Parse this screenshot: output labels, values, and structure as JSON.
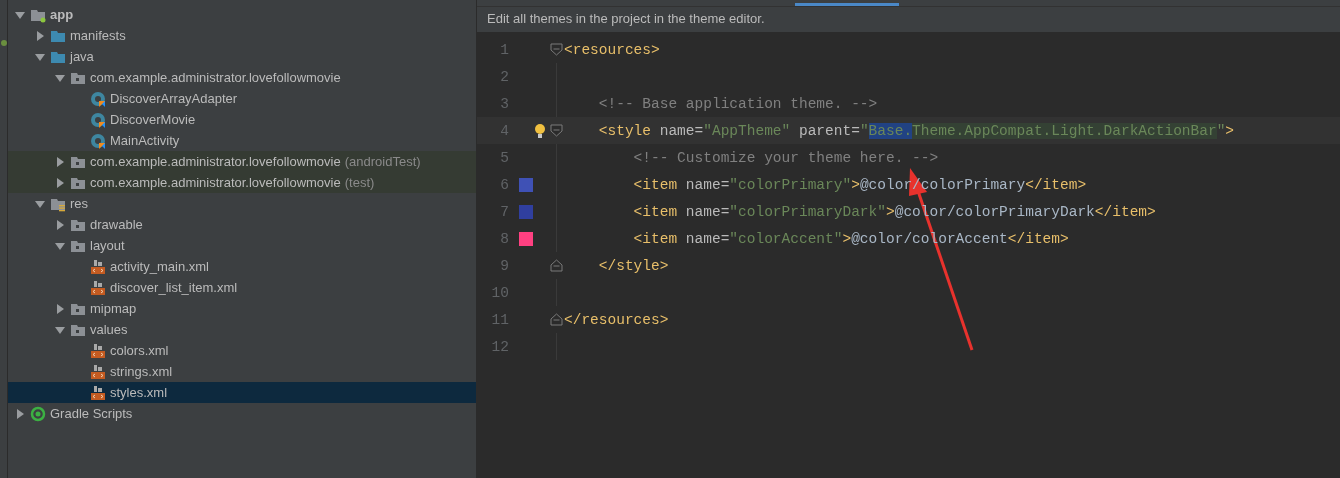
{
  "project_tree": [
    {
      "label": "app",
      "kind": "module",
      "expanded": true,
      "selected": false,
      "tinted": false,
      "children": [
        {
          "label": "manifests",
          "kind": "folder",
          "expanded": false,
          "selected": false,
          "tinted": false
        },
        {
          "label": "java",
          "kind": "folder",
          "expanded": true,
          "selected": false,
          "tinted": false,
          "children": [
            {
              "label": "com.example.administrator.lovefollowmovie",
              "kind": "package",
              "expanded": true,
              "selected": false,
              "tinted": false,
              "children": [
                {
                  "label": "DiscoverArrayAdapter",
                  "kind": "class",
                  "selected": false,
                  "tinted": false
                },
                {
                  "label": "DiscoverMovie",
                  "kind": "class",
                  "selected": false,
                  "tinted": false
                },
                {
                  "label": "MainActivity",
                  "kind": "class",
                  "selected": false,
                  "tinted": false
                }
              ]
            },
            {
              "label": "com.example.administrator.lovefollowmovie",
              "suffix": "(androidTest)",
              "kind": "package",
              "expanded": false,
              "selected": false,
              "tinted": true
            },
            {
              "label": "com.example.administrator.lovefollowmovie",
              "suffix": "(test)",
              "kind": "package",
              "expanded": false,
              "selected": false,
              "tinted": true
            }
          ]
        },
        {
          "label": "res",
          "kind": "resfolder",
          "expanded": true,
          "selected": false,
          "tinted": false,
          "children": [
            {
              "label": "drawable",
              "kind": "package",
              "expanded": false,
              "selected": false,
              "tinted": false
            },
            {
              "label": "layout",
              "kind": "package",
              "expanded": true,
              "selected": false,
              "tinted": false,
              "children": [
                {
                  "label": "activity_main.xml",
                  "kind": "xml",
                  "selected": false,
                  "tinted": false
                },
                {
                  "label": "discover_list_item.xml",
                  "kind": "xml",
                  "selected": false,
                  "tinted": false
                }
              ]
            },
            {
              "label": "mipmap",
              "kind": "package",
              "expanded": false,
              "selected": false,
              "tinted": false
            },
            {
              "label": "values",
              "kind": "package",
              "expanded": true,
              "selected": false,
              "tinted": false,
              "children": [
                {
                  "label": "colors.xml",
                  "kind": "xml",
                  "selected": false,
                  "tinted": false
                },
                {
                  "label": "strings.xml",
                  "kind": "xml",
                  "selected": false,
                  "tinted": false
                },
                {
                  "label": "styles.xml",
                  "kind": "xml",
                  "selected": true,
                  "tinted": false
                }
              ]
            }
          ]
        }
      ]
    },
    {
      "label": "Gradle Scripts",
      "kind": "gradle",
      "expanded": false,
      "selected": false,
      "tinted": false
    }
  ],
  "editor": {
    "notice": "Edit all themes in the project in the theme editor.",
    "lines": [
      {
        "number": "1",
        "fold_start": true,
        "current": false,
        "segments": [
          {
            "kind": "tag",
            "text": "<resources>"
          }
        ]
      },
      {
        "number": "2",
        "current": false
      },
      {
        "number": "3",
        "current": false,
        "segments": [
          {
            "kind": "comment",
            "text": "    <!-- Base application theme. -->"
          }
        ]
      },
      {
        "number": "4",
        "fold_start": true,
        "bulb": true,
        "current": true,
        "segments": [
          {
            "kind": "tag",
            "text": "    <style "
          },
          {
            "kind": "attr",
            "text": "name="
          },
          {
            "kind": "str",
            "text": "\"AppTheme\""
          },
          {
            "kind": "attr",
            "text": " parent="
          },
          {
            "kind": "str",
            "text": "\""
          },
          {
            "kind": "str",
            "text": "Base.",
            "selected": true,
            "match": true
          },
          {
            "kind": "str",
            "text": "Theme.AppCompat.Light.DarkActionBar",
            "match": true
          },
          {
            "kind": "str",
            "text": "\""
          },
          {
            "kind": "tag",
            "text": ">"
          }
        ]
      },
      {
        "number": "5",
        "current": false,
        "segments": [
          {
            "kind": "comment",
            "text": "        <!-- Customize your theme here. -->"
          }
        ]
      },
      {
        "number": "6",
        "color": "#3f51b5",
        "current": false,
        "segments": [
          {
            "kind": "tag",
            "text": "        <item "
          },
          {
            "kind": "attr",
            "text": "name="
          },
          {
            "kind": "str",
            "text": "\"colorPrimary\""
          },
          {
            "kind": "tag",
            "text": ">"
          },
          {
            "kind": "text",
            "text": "@color/colorPrimary"
          },
          {
            "kind": "tag",
            "text": "</item>"
          }
        ]
      },
      {
        "number": "7",
        "color": "#303f9f",
        "current": false,
        "segments": [
          {
            "kind": "tag",
            "text": "        <item "
          },
          {
            "kind": "attr",
            "text": "name="
          },
          {
            "kind": "str",
            "text": "\"colorPrimaryDark\""
          },
          {
            "kind": "tag",
            "text": ">"
          },
          {
            "kind": "text",
            "text": "@color/colorPrimaryDark"
          },
          {
            "kind": "tag",
            "text": "</item>"
          }
        ]
      },
      {
        "number": "8",
        "color": "#ff4081",
        "current": false,
        "segments": [
          {
            "kind": "tag",
            "text": "        <item "
          },
          {
            "kind": "attr",
            "text": "name="
          },
          {
            "kind": "str",
            "text": "\"colorAccent\""
          },
          {
            "kind": "tag",
            "text": ">"
          },
          {
            "kind": "text",
            "text": "@color/colorAccent"
          },
          {
            "kind": "tag",
            "text": "</item>"
          }
        ]
      },
      {
        "number": "9",
        "fold_end": true,
        "current": false,
        "segments": [
          {
            "kind": "tag",
            "text": "    </style>"
          }
        ]
      },
      {
        "number": "10",
        "current": false
      },
      {
        "number": "11",
        "fold_end": true,
        "current": false,
        "segments": [
          {
            "kind": "tag",
            "text": "</resources>"
          }
        ]
      },
      {
        "number": "12",
        "current": false
      }
    ]
  }
}
